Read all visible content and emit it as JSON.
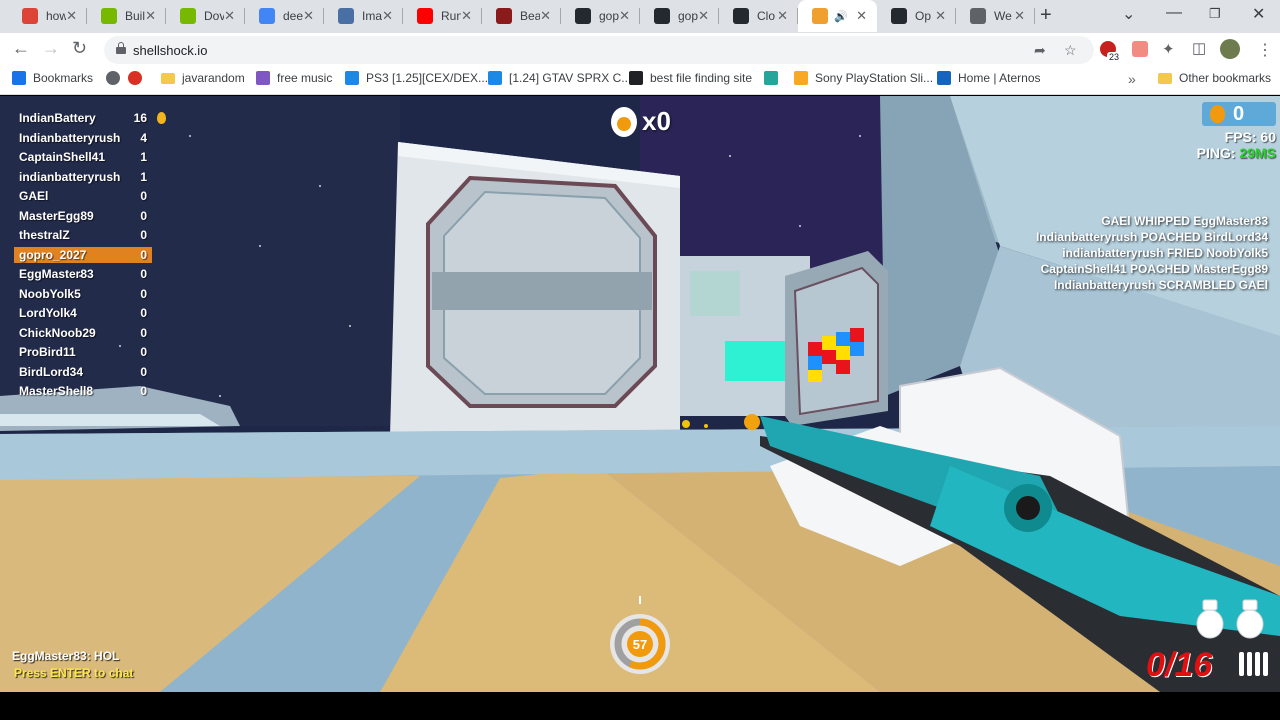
{
  "browser": {
    "tabs": [
      {
        "label": "how",
        "color": "#db4437"
      },
      {
        "label": "Buil",
        "color": "#76b900"
      },
      {
        "label": "Dov",
        "color": "#76b900"
      },
      {
        "label": "dee",
        "color": "#4285f4"
      },
      {
        "label": "Ima",
        "color": "#4a6fa5"
      },
      {
        "label": "Run",
        "color": "#ff0000"
      },
      {
        "label": "Bea",
        "color": "#8b1a1a"
      },
      {
        "label": "gop",
        "color": "#24292f"
      },
      {
        "label": "gop",
        "color": "#24292f"
      },
      {
        "label": "Clo",
        "color": "#24292f"
      },
      {
        "label": "",
        "color": "#f0a030",
        "active": true
      },
      {
        "label": "Op",
        "color": "#24292f"
      },
      {
        "label": "We",
        "color": "#5f6368"
      }
    ],
    "url": "shellshock.io",
    "extension_badge": "23",
    "bookmarks": [
      {
        "label": "Bookmarks",
        "icon": "star-icon"
      },
      {
        "label": "",
        "icon": "globe-icon"
      },
      {
        "label": "",
        "icon": "heart-icon"
      },
      {
        "label": "javarandom",
        "icon": "folder-icon"
      },
      {
        "label": "free music",
        "icon": "alien-icon"
      },
      {
        "label": "PS3 [1.25][CEX/DEX...",
        "icon": "c-icon"
      },
      {
        "label": "[1.24] GTAV SPRX C...",
        "icon": "c-icon"
      },
      {
        "label": "best file finding site",
        "icon": "printer-icon"
      },
      {
        "label": "",
        "icon": "app-icon"
      },
      {
        "label": "Sony PlayStation Sli...",
        "icon": "bag-icon"
      },
      {
        "label": "Home | Aternos",
        "icon": "aternos-icon"
      },
      {
        "label": "Other bookmarks",
        "icon": "folder-icon"
      }
    ]
  },
  "game": {
    "leaderboard": [
      {
        "name": "IndianBattery",
        "score": "16"
      },
      {
        "name": "Indianbatteryrush",
        "score": "4"
      },
      {
        "name": "CaptainShell41",
        "score": "1"
      },
      {
        "name": "indianbatteryrush",
        "score": "1"
      },
      {
        "name": "GAEl",
        "score": "0"
      },
      {
        "name": "MasterEgg89",
        "score": "0"
      },
      {
        "name": "thestralZ",
        "score": "0"
      },
      {
        "name": "gopro_2027",
        "score": "0",
        "me": true
      },
      {
        "name": "EggMaster83",
        "score": "0"
      },
      {
        "name": "NoobYolk5",
        "score": "0"
      },
      {
        "name": "LordYolk4",
        "score": "0"
      },
      {
        "name": "ChickNoob29",
        "score": "0"
      },
      {
        "name": "ProBird11",
        "score": "0"
      },
      {
        "name": "BirdLord34",
        "score": "0"
      },
      {
        "name": "MasterShell8",
        "score": "0"
      }
    ],
    "streak": "x0",
    "eggs": "0",
    "fps_label": "FPS: 60",
    "ping_label": "PING: ",
    "ping_value": "29MS",
    "killfeed": [
      "GAEl WHIPPED EggMaster83",
      "Indianbatteryrush POACHED BirdLord34",
      "indianbatteryrush FRIED NoobYolk5",
      "CaptainShell41 POACHED MasterEgg89",
      "Indianbatteryrush SCRAMBLED GAEl"
    ],
    "chat_message": "EggMaster83: HOL",
    "chat_hint": "Press ENTER to chat",
    "health": "57",
    "health_fraction": 0.57,
    "ammo": "0/16",
    "grenades": 2,
    "colors": {
      "accent": "#e0821f",
      "ping_good": "#2dd12d",
      "ammo_empty": "#e01010",
      "chat_hint": "#ffe84a"
    }
  }
}
